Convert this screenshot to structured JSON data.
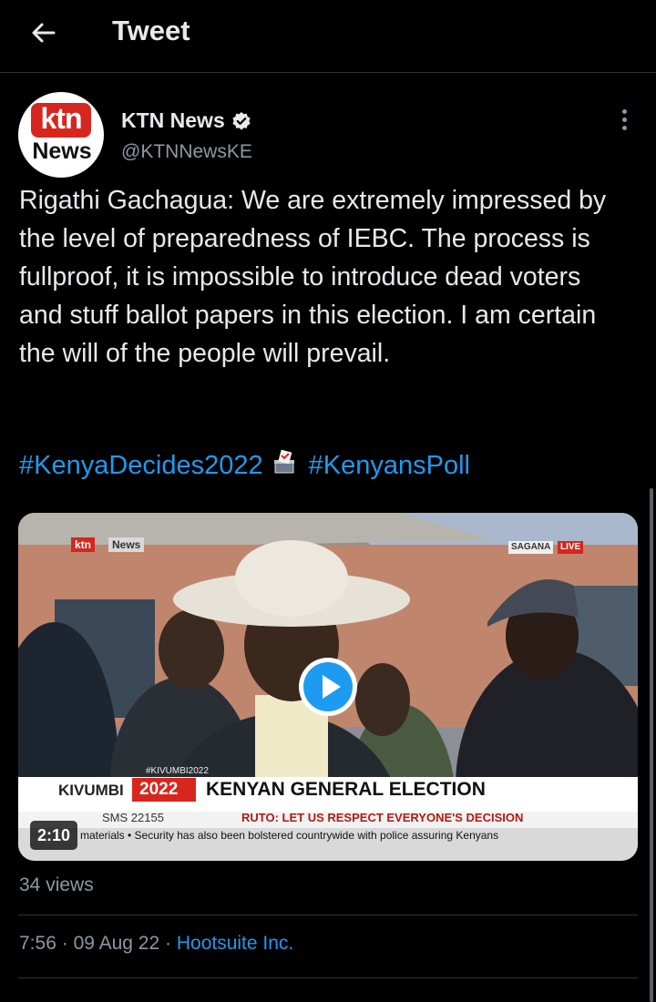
{
  "header": {
    "title": "Tweet"
  },
  "author": {
    "name": "KTN News",
    "handle": "@KTNNewsKE",
    "avatar_top": "ktn",
    "avatar_bottom": "News"
  },
  "tweet": {
    "text": "Rigathi Gachagua: We are extremely impressed by the level of preparedness of IEBC. The process is fullproof, it is impossible to introduce dead voters and stuff ballot papers in this election. I am certain the will of the people will prevail.",
    "hashtags": [
      "#KenyaDecides2022",
      "#KenyansPoll"
    ]
  },
  "video": {
    "duration": "2:10",
    "logo_ktn": "ktn",
    "logo_news": "News",
    "location": "SAGANA",
    "live": "LIVE",
    "hashtag_overlay": "#KIVUMBI2022",
    "ticker_label": "KIVUMBI",
    "ticker_year": "2022",
    "ticker_headline": "KENYAN GENERAL ELECTION",
    "sms": "SMS 22155",
    "subheadline": "RUTO: LET US RESPECT EVERYONE'S DECISION",
    "crawl": "materials  •  Security has also been bolstered countrywide with police assuring Kenyans"
  },
  "stats": {
    "views": "34 views"
  },
  "meta": {
    "time": "7:56",
    "separator": "·",
    "date": "09 Aug 22",
    "source": "Hootsuite Inc."
  },
  "colors": {
    "accent": "#1d9bf0",
    "background": "#000000",
    "muted": "#8b98a5",
    "brand_red": "#d7261e"
  }
}
